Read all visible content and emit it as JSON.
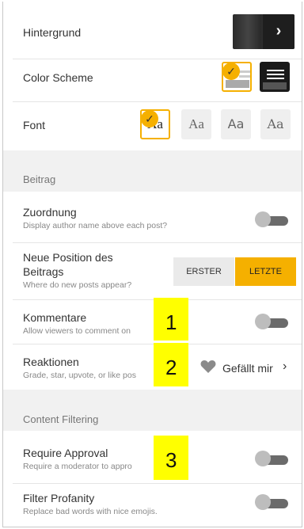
{
  "rows": {
    "hintergrund": "Hintergrund",
    "color_scheme": "Color Scheme",
    "font": "Font",
    "font_sample": "Aa",
    "zuordnung": "Zuordnung",
    "zuordnung_sub": "Display author name above each post?",
    "position_line1": "Neue Position des",
    "position_line2": "Beitrags",
    "position_sub": "Where do new posts appear?",
    "kommentare": "Kommentare",
    "kommentare_sub": "Allow viewers to comment on",
    "reaktionen": "Reaktionen",
    "reaktionen_sub": "Grade, star, upvote, or like pos",
    "require": "Require Approval",
    "require_sub": "Require a moderator to appro",
    "filter": "Filter Profanity",
    "filter_sub": "Replace bad words with nice emojis."
  },
  "sections": {
    "beitrag": "Beitrag",
    "filtering": "Content Filtering"
  },
  "position_options": {
    "first": "ERSTER",
    "last": "LETZTE",
    "selected": "LETZTE"
  },
  "reaction_value": "Gefällt mir",
  "icons": {
    "check": "✓",
    "chevron": "›"
  },
  "callouts": [
    "1",
    "2",
    "3"
  ],
  "toggles": {
    "zuordnung": false,
    "kommentare": false,
    "require": false,
    "filter": false
  },
  "colors": {
    "accent": "#f5b000",
    "callout": "#ffff00"
  }
}
